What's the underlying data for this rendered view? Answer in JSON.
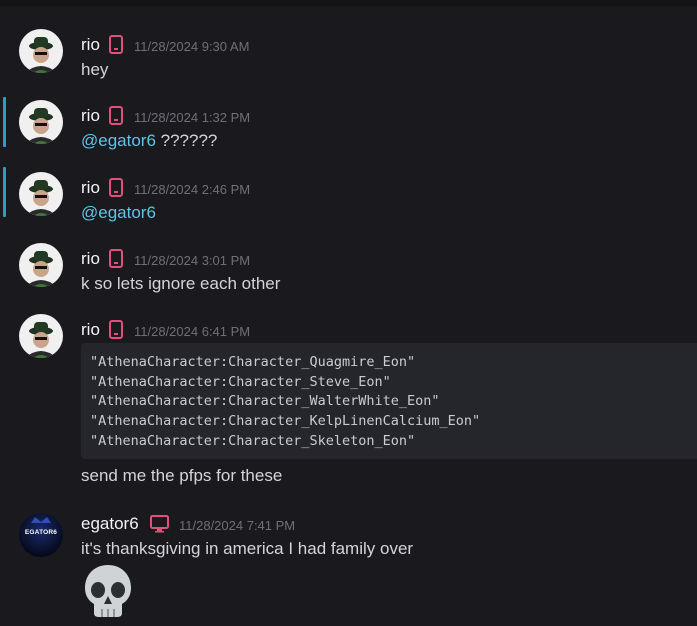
{
  "messages": [
    {
      "author": "rio",
      "timestamp": "11/28/2024 9:30 AM",
      "text": "hey",
      "device": "mobile-icon"
    },
    {
      "author": "rio",
      "timestamp": "11/28/2024 1:32 PM",
      "mention": "@egator6",
      "text": " ??????",
      "device": "mobile-icon"
    },
    {
      "author": "rio",
      "timestamp": "11/28/2024 2:46 PM",
      "mention": "@egator6",
      "text": "",
      "device": "mobile-icon"
    },
    {
      "author": "rio",
      "timestamp": "11/28/2024 3:01 PM",
      "text": "k so lets ignore each other",
      "device": "mobile-icon"
    },
    {
      "author": "rio",
      "timestamp": "11/28/2024 6:41 PM",
      "text": "send me the pfps for these",
      "device": "mobile-icon",
      "code": [
        "\"AthenaCharacter:Character_Quagmire_Eon\"",
        "\"AthenaCharacter:Character_Steve_Eon\"",
        "\"AthenaCharacter:Character_WalterWhite_Eon\"",
        "\"AthenaCharacter:Character_KelpLinenCalcium_Eon\"",
        "\"AthenaCharacter:Character_Skeleton_Eon\""
      ]
    },
    {
      "author": "egator6",
      "timestamp": "11/28/2024 7:41 PM",
      "text": "it's thanksgiving in america I had family over",
      "device": "desktop-icon",
      "avatar_text": "EGATOR6",
      "emoji": "skull-emoji"
    }
  ],
  "colors": {
    "background": "#1a1a1e",
    "device_icon": "#e0507a",
    "mention": "#5fc4e6",
    "mention_bar": "#2aa0c0",
    "timestamp": "#6e7078"
  }
}
